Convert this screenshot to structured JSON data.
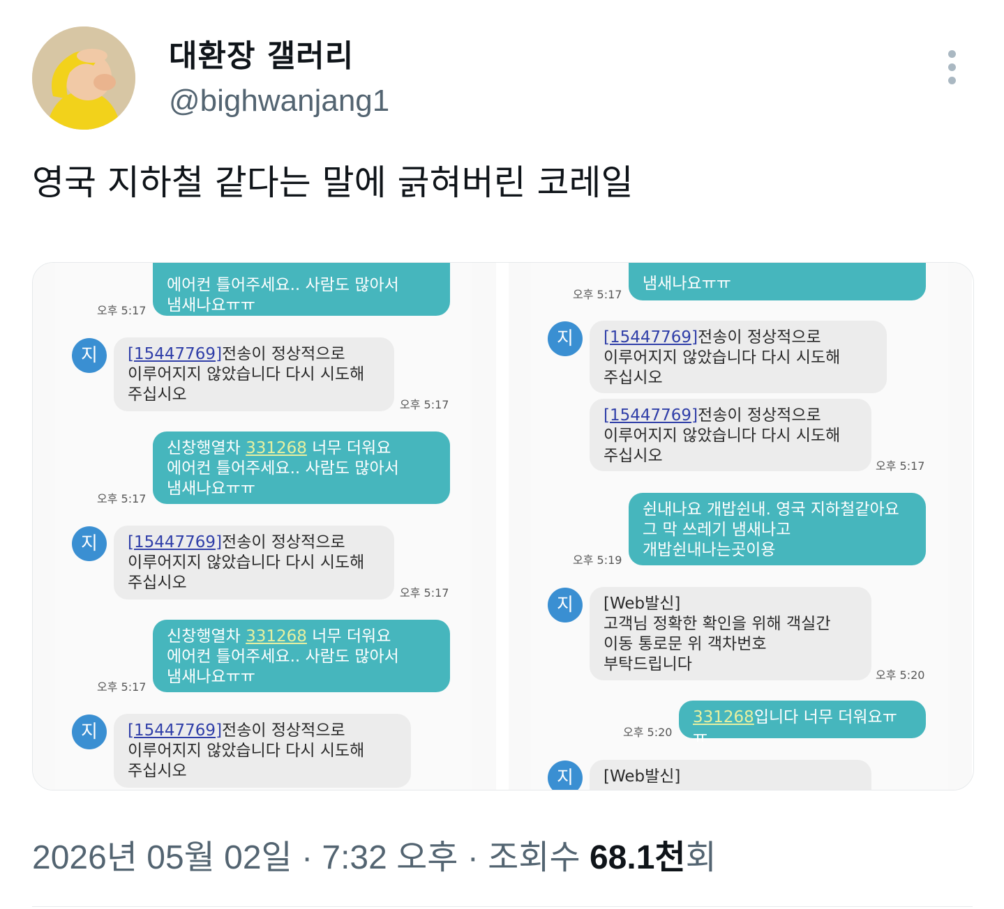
{
  "author": {
    "display_name": "대환장 갤러리",
    "handle": "@bighwanjang1"
  },
  "tweet": {
    "text": "영국 지하철 같다는 말에 긁혀버린 코레일"
  },
  "left_panel": {
    "msgs": [
      {
        "type": "out",
        "text": "에어컨 틀어주세요.. 사람도 많아서\n냄새나요ㅠㅠ",
        "time": "오후 5:17"
      },
      {
        "type": "in",
        "avatar": "지",
        "num": "15447769",
        "text": "전송이 정상적으로\n이루어지지 않았습니다 다시 시도해\n주십시오",
        "time": "오후 5:17"
      },
      {
        "type": "out",
        "prefix": "신창행열차 ",
        "num": "331268",
        "text": " 너무 더워요\n에어컨 틀어주세요.. 사람도 많아서\n냄새나요ㅠㅠ",
        "time": "오후 5:17"
      },
      {
        "type": "in",
        "avatar": "지",
        "num": "15447769",
        "text": "전송이 정상적으로\n이루어지지 않았습니다 다시 시도해\n주십시오",
        "time": "오후 5:17"
      },
      {
        "type": "out",
        "prefix": "신창행열차 ",
        "num": "331268",
        "text": " 너무 더워요\n에어컨 틀어주세요.. 사람도 많아서\n냄새나요ㅠㅠ",
        "time": "오후 5:17"
      },
      {
        "type": "in",
        "avatar": "지",
        "num": "15447769",
        "text": "전송이 정상적으로\n이루어지지 않았습니다 다시 시도해\n주십시오"
      }
    ]
  },
  "right_panel": {
    "msgs": [
      {
        "type": "out",
        "text": "냄새나요ㅠㅠ",
        "time": "오후 5:17"
      },
      {
        "type": "in",
        "avatar": "지",
        "num": "15447769",
        "text": "전송이 정상적으로\n이루어지지 않았습니다 다시 시도해\n주십시오"
      },
      {
        "type": "in",
        "num": "15447769",
        "text": "전송이 정상적으로\n이루어지지 않았습니다 다시 시도해\n주십시오",
        "time": "오후 5:17"
      },
      {
        "type": "out",
        "text": "쉰내나요 개밥쉰내. 영국 지하철같아요\n그 막 쓰레기 냄새나고\n개밥쉰내나는곳이용",
        "time": "오후 5:19"
      },
      {
        "type": "in",
        "avatar": "지",
        "text": "[Web발신]\n고객님 정확한 확인을 위해 객실간\n이동 통로문 위 객차번호\n부탁드립니다",
        "time": "오후 5:20"
      },
      {
        "type": "out",
        "num": "331268",
        "text": "입니다 너무 더워요ㅠㅠ",
        "time": "오후 5:20"
      },
      {
        "type": "in",
        "avatar": "지",
        "text": "[Web발신]"
      }
    ]
  },
  "meta": {
    "date": "2026년 05월 02일",
    "time": "7:32 오후",
    "views_label": "조회수",
    "views_count": "68.1천",
    "views_suffix": "회"
  }
}
